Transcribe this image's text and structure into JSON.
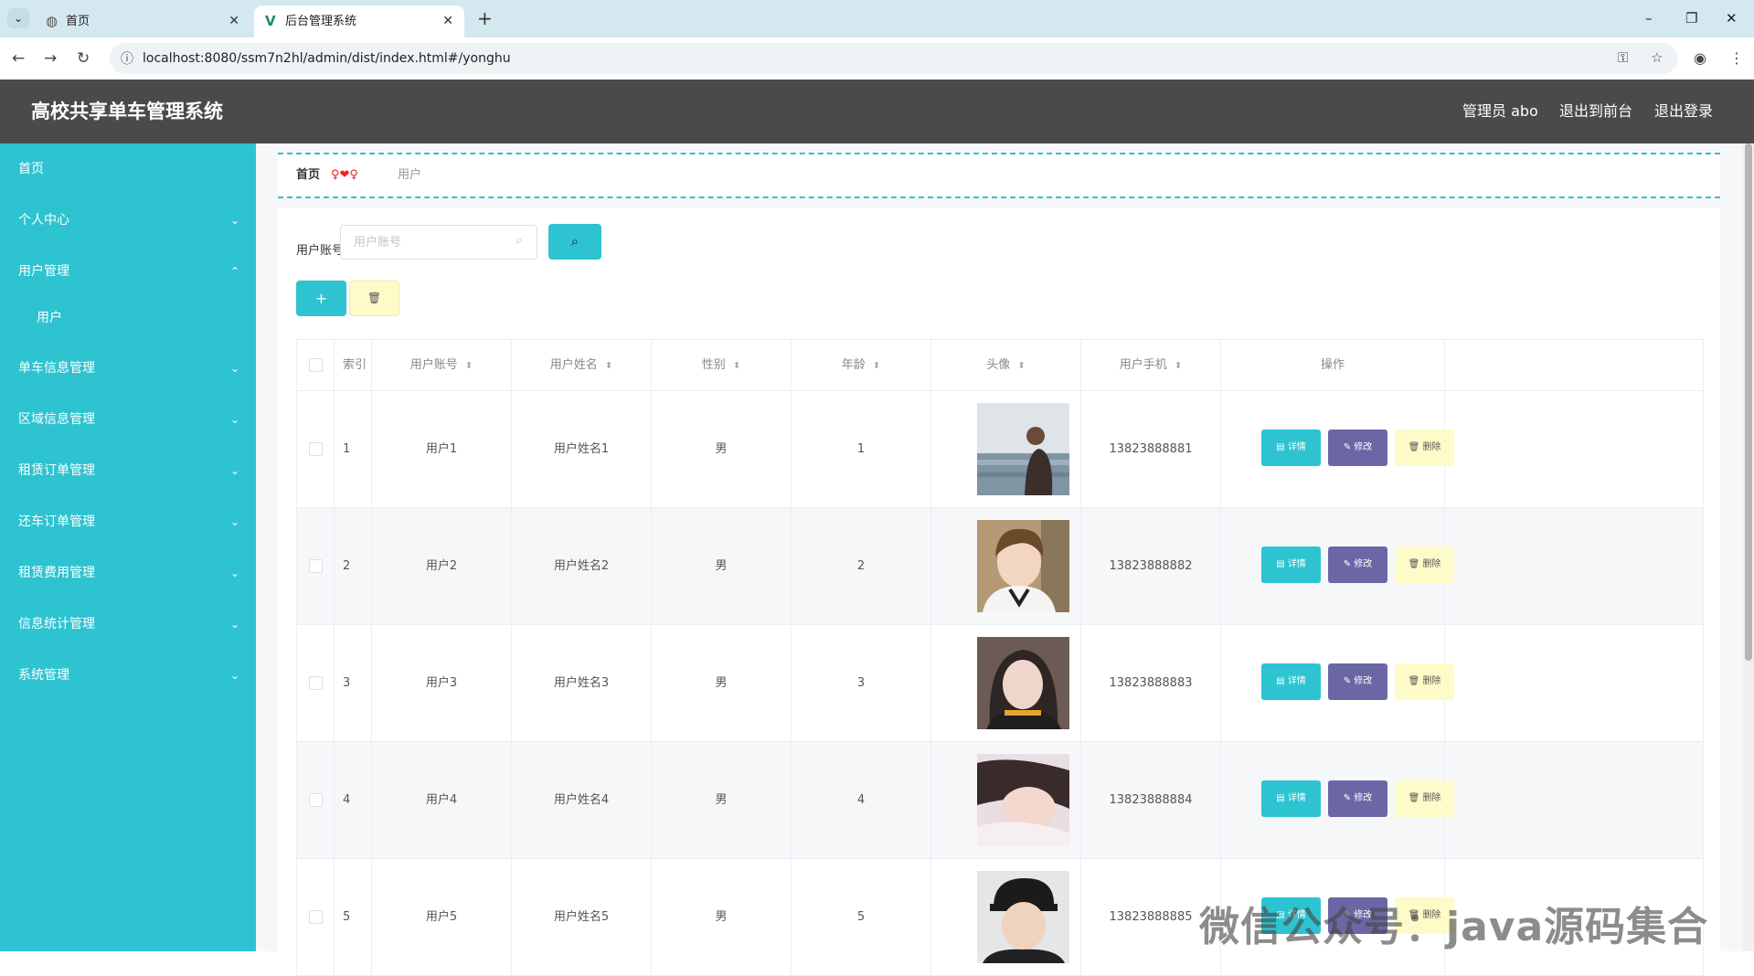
{
  "browser": {
    "tabs": [
      {
        "label": "首页",
        "icon": "globe-icon"
      },
      {
        "label": "后台管理系统",
        "icon": "vue-logo-icon"
      }
    ],
    "url": "localhost:8080/ssm7n2hl/admin/dist/index.html#/yonghu"
  },
  "header": {
    "title": "高校共享单车管理系统",
    "admin_label": "管理员 abo",
    "to_front_label": "退出到前台",
    "logout_label": "退出登录"
  },
  "sidebar": {
    "items": [
      {
        "label": "首页"
      },
      {
        "label": "个人中心"
      },
      {
        "label": "用户管理"
      },
      {
        "label": "用户"
      },
      {
        "label": "单车信息管理"
      },
      {
        "label": "区域信息管理"
      },
      {
        "label": "租赁订单管理"
      },
      {
        "label": "还车订单管理"
      },
      {
        "label": "租赁费用管理"
      },
      {
        "label": "信息统计管理"
      },
      {
        "label": "系统管理"
      }
    ]
  },
  "breadcrumb": {
    "home": "首页",
    "separator": "♀❤♀",
    "current": "用户"
  },
  "search": {
    "label": "用户账号",
    "placeholder": "用户账号",
    "button_icon": "search-icon"
  },
  "toolbar": {
    "add_label": "+",
    "delete_icon": "trash-icon"
  },
  "table": {
    "columns": [
      "索引",
      "用户账号",
      "用户姓名",
      "性别",
      "年龄",
      "头像",
      "用户手机",
      "操作"
    ],
    "rows": [
      {
        "index": "1",
        "account": "用户1",
        "name": "用户姓名1",
        "gender": "男",
        "age": "1",
        "phone": "13823888881"
      },
      {
        "index": "2",
        "account": "用户2",
        "name": "用户姓名2",
        "gender": "男",
        "age": "2",
        "phone": "13823888882"
      },
      {
        "index": "3",
        "account": "用户3",
        "name": "用户姓名3",
        "gender": "男",
        "age": "3",
        "phone": "13823888883"
      },
      {
        "index": "4",
        "account": "用户4",
        "name": "用户姓名4",
        "gender": "男",
        "age": "4",
        "phone": "13823888884"
      },
      {
        "index": "5",
        "account": "用户5",
        "name": "用户姓名5",
        "gender": "男",
        "age": "5",
        "phone": "13823888885"
      }
    ],
    "actions": {
      "detail": "详情",
      "edit": "修改",
      "delete": "删除"
    }
  },
  "watermark": "微信公众号：java源码集合"
}
